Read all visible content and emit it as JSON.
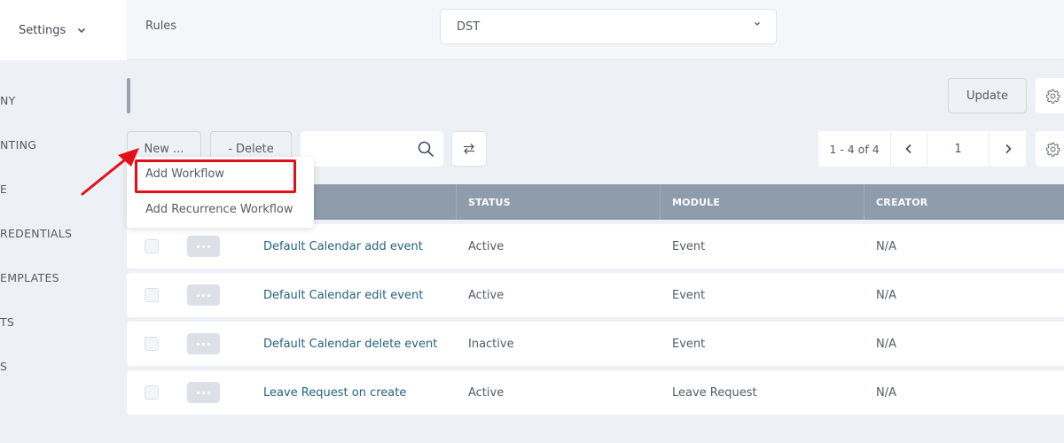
{
  "topbar": {
    "settings_label": "Settings",
    "rules_label": "Rules",
    "module_select_value": "DST"
  },
  "sidebar": {
    "items": [
      {
        "label": "NY"
      },
      {
        "label": "NTING"
      },
      {
        "label": "E"
      },
      {
        "label": "REDENTIALS"
      },
      {
        "label": "EMPLATES"
      },
      {
        "label": "TS"
      },
      {
        "label": "S"
      }
    ]
  },
  "toolbar": {
    "update_label": "Update",
    "new_label": "New ...",
    "delete_label": "- Delete",
    "search_value": "",
    "pagination_range": "1 - 4 of 4",
    "current_page": "1"
  },
  "new_menu": {
    "items": [
      {
        "label": "Add Workflow"
      },
      {
        "label": "Add Recurrence Workflow"
      }
    ]
  },
  "table": {
    "columns": [
      "STATUS",
      "MODULE",
      "CREATOR"
    ],
    "rows": [
      {
        "name": "Default Calendar add event",
        "status": "Active",
        "module": "Event",
        "creator": "N/A"
      },
      {
        "name": "Default Calendar edit event",
        "status": "Active",
        "module": "Event",
        "creator": "N/A"
      },
      {
        "name": "Default Calendar delete event",
        "status": "Inactive",
        "module": "Event",
        "creator": "N/A"
      },
      {
        "name": "Leave Request on create",
        "status": "Active",
        "module": "Leave Request",
        "creator": "N/A"
      }
    ]
  },
  "colors": {
    "header_bg": "#8f9cab",
    "link": "#236383",
    "annotation": "#e3101a"
  }
}
